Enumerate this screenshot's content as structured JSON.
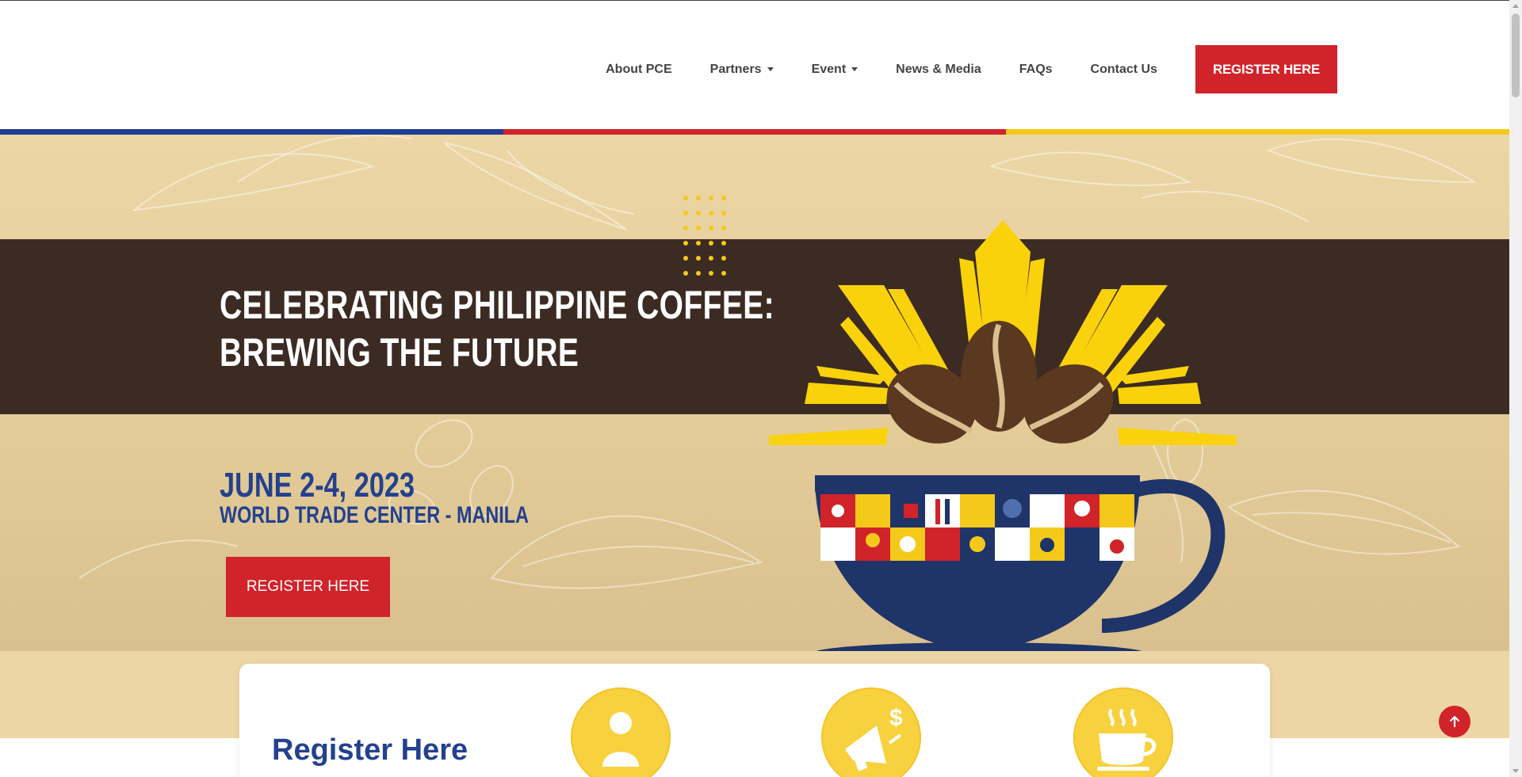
{
  "nav": {
    "items": [
      {
        "label": "About PCE",
        "dropdown": false
      },
      {
        "label": "Partners",
        "dropdown": true
      },
      {
        "label": "Event",
        "dropdown": true
      },
      {
        "label": "News & Media",
        "dropdown": false
      },
      {
        "label": "FAQs",
        "dropdown": false
      },
      {
        "label": "Contact Us",
        "dropdown": false
      }
    ],
    "register_label": "REGISTER HERE"
  },
  "stripe_colors": [
    "#1f3f95",
    "#d1232a",
    "#f5c91a"
  ],
  "hero": {
    "headline_line1": "CELEBRATING PHILIPPINE COFFEE:",
    "headline_line2": "BREWING THE FUTURE",
    "date": "JUNE 2-4, 2023",
    "venue": "WORLD TRADE CENTER - MANILA",
    "register_label": "REGISTER HERE"
  },
  "card": {
    "title": "Register Here",
    "icons": [
      "person-icon",
      "megaphone-dollar-icon",
      "coffee-cup-icon"
    ]
  },
  "colors": {
    "brand_red": "#d1232a",
    "brand_blue": "#23418e",
    "band_brown": "#3c2b23",
    "sun_yellow": "#f9d20b",
    "hero_beige": "#ecd6a6"
  }
}
